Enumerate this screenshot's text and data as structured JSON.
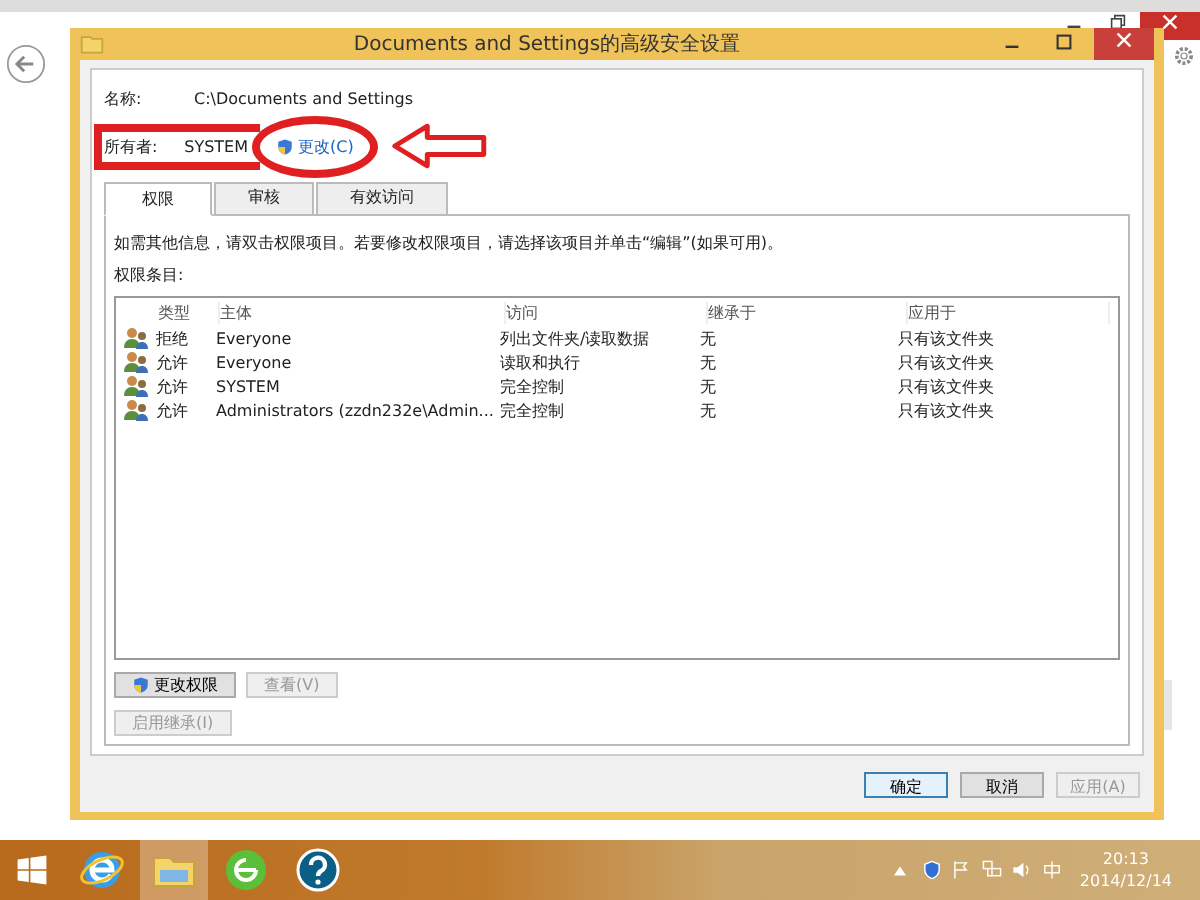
{
  "window": {
    "title": "Documents and Settings的高级安全设置"
  },
  "name": {
    "label": "名称:",
    "value": "C:\\Documents and Settings"
  },
  "owner": {
    "label": "所有者:",
    "value": "SYSTEM",
    "change_link": "更改(C)"
  },
  "tabs": [
    {
      "label": "权限",
      "selected": true
    },
    {
      "label": "审核",
      "selected": false
    },
    {
      "label": "有效访问",
      "selected": false
    }
  ],
  "info_text": "如需其他信息，请双击权限项目。若要修改权限项目，请选择该项目并单击“编辑”(如果可用)。",
  "entries_label": "权限条目:",
  "table": {
    "columns": [
      "类型",
      "主体",
      "访问",
      "继承于",
      "应用于"
    ],
    "rows": [
      {
        "type": "拒绝",
        "principal": "Everyone",
        "access": "列出文件夹/读取数据",
        "inherited": "无",
        "applies": "只有该文件夹"
      },
      {
        "type": "允许",
        "principal": "Everyone",
        "access": "读取和执行",
        "inherited": "无",
        "applies": "只有该文件夹"
      },
      {
        "type": "允许",
        "principal": "SYSTEM",
        "access": "完全控制",
        "inherited": "无",
        "applies": "只有该文件夹"
      },
      {
        "type": "允许",
        "principal": "Administrators (zzdn232e\\Admin...",
        "access": "完全控制",
        "inherited": "无",
        "applies": "只有该文件夹"
      }
    ]
  },
  "panel_buttons": [
    {
      "label": "更改权限",
      "disabled": false,
      "shield": true
    },
    {
      "label": "查看(V)",
      "disabled": true,
      "shield": false
    }
  ],
  "inherit_button": {
    "label": "启用继承(I)",
    "disabled": true
  },
  "footer_buttons": [
    {
      "label": "确定",
      "disabled": false,
      "default": true
    },
    {
      "label": "取消",
      "disabled": false,
      "default": false
    },
    {
      "label": "应用(A)",
      "disabled": true,
      "default": false
    }
  ],
  "taskbar": {
    "time": "20:13",
    "date": "2014/12/14"
  }
}
